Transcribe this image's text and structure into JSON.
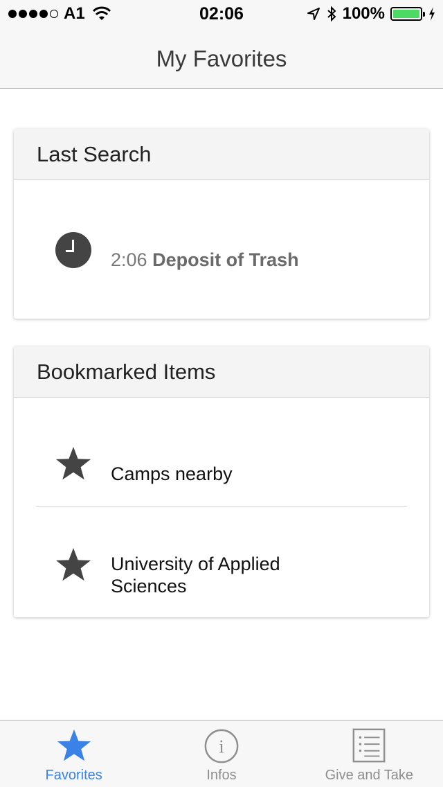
{
  "status_bar": {
    "carrier": "A1",
    "time": "02:06",
    "battery_percent": "100%",
    "battery_level": 1.0,
    "signal_bars": 4,
    "icons": [
      "wifi-icon",
      "location-arrow-icon",
      "bluetooth-icon",
      "battery-icon",
      "charging-bolt-icon"
    ]
  },
  "nav": {
    "title": "My Favorites"
  },
  "last_search": {
    "header": "Last Search",
    "time": "2:06",
    "title": "Deposit of Trash",
    "icon": "clock-icon"
  },
  "bookmarks": {
    "header": "Bookmarked Items",
    "items": [
      {
        "label": "Camps nearby",
        "icon": "star-icon"
      },
      {
        "label": "University of Applied Sciences",
        "icon": "star-icon"
      }
    ]
  },
  "tab_bar": {
    "tabs": [
      {
        "label": "Favorites",
        "icon": "star-icon",
        "active": true
      },
      {
        "label": "Infos",
        "icon": "info-icon",
        "active": false
      },
      {
        "label": "Give and Take",
        "icon": "list-icon",
        "active": false
      }
    ]
  },
  "colors": {
    "accent": "#3b82e6",
    "battery": "#4cd964",
    "icon_dark": "#444444",
    "tab_inactive": "#8e8e8e"
  }
}
